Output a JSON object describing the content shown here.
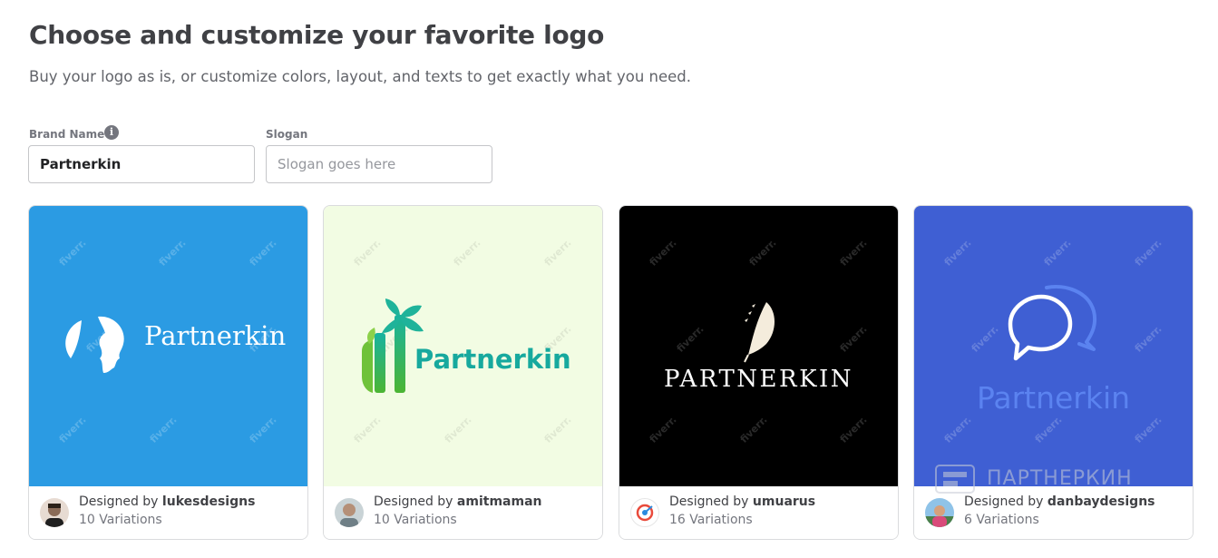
{
  "header": {
    "title": "Choose and customize your favorite logo",
    "subtitle": "Buy your logo as is, or customize colors, layout, and texts to get exactly what you need."
  },
  "form": {
    "brand_label": "Brand Name",
    "brand_value": "Partnerkin",
    "slogan_label": "Slogan",
    "slogan_placeholder": "Slogan goes here",
    "info_icon": "info-icon"
  },
  "watermark_text": "fiverr.",
  "cards": [
    {
      "designed_prefix": "Designed by",
      "designer": "lukesdesigns",
      "variations": "10 Variations",
      "logo_text": "Partnerkin",
      "bg": "#2b9be3"
    },
    {
      "designed_prefix": "Designed by",
      "designer": "amitmaman",
      "variations": "10 Variations",
      "logo_text": "Partnerkin",
      "bg": "#f2fce3"
    },
    {
      "designed_prefix": "Designed by",
      "designer": "umuarus",
      "variations": "16 Variations",
      "logo_text": "PARTNERKIN",
      "bg": "#000000"
    },
    {
      "designed_prefix": "Designed by",
      "designer": "danbaydesigns",
      "variations": "6 Variations",
      "logo_text": "Partnerkin",
      "bg": "#3f5fd3"
    }
  ],
  "overlay_watermark": {
    "text": "ПАРТНЕРКИН"
  }
}
